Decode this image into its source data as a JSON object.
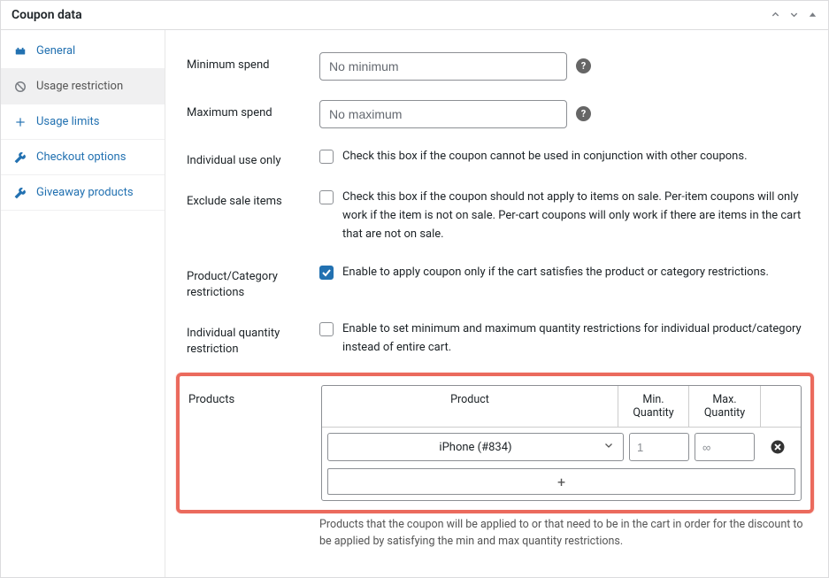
{
  "panel": {
    "title": "Coupon data",
    "controls": {
      "up": "⌃",
      "down": "⌄",
      "collapse": "▲"
    }
  },
  "sidebar": {
    "items": [
      {
        "label": "General"
      },
      {
        "label": "Usage restriction"
      },
      {
        "label": "Usage limits"
      },
      {
        "label": "Checkout options"
      },
      {
        "label": "Giveaway products"
      }
    ]
  },
  "fields": {
    "min_spend": {
      "label": "Minimum spend",
      "placeholder": "No minimum"
    },
    "max_spend": {
      "label": "Maximum spend",
      "placeholder": "No maximum"
    },
    "individual_use": {
      "label": "Individual use only",
      "text": "Check this box if the coupon cannot be used in conjunction with other coupons."
    },
    "exclude_sale": {
      "label": "Exclude sale items",
      "text": "Check this box if the coupon should not apply to items on sale. Per-item coupons will only work if the item is not on sale. Per-cart coupons will only work if there are items in the cart that are not on sale."
    },
    "pc_restrictions": {
      "label": "Product/Category restrictions",
      "text": "Enable to apply coupon only if the cart satisfies the product or category restrictions."
    },
    "iq_restriction": {
      "label": "Individual quantity restriction",
      "text": "Enable to set minimum and maximum quantity restrictions for individual product/category instead of entire cart."
    },
    "products": {
      "label": "Products",
      "headers": {
        "product": "Product",
        "min": "Min. Quantity",
        "max": "Max. Quantity"
      },
      "row": {
        "product": "iPhone (#834)",
        "min_placeholder": "1",
        "max_placeholder": "∞"
      },
      "add": "+",
      "hint": "Products that the coupon will be applied to or that need to be in the cart in order for the discount to be applied by satisfying the min and max quantity restrictions."
    }
  },
  "help_glyph": "?"
}
